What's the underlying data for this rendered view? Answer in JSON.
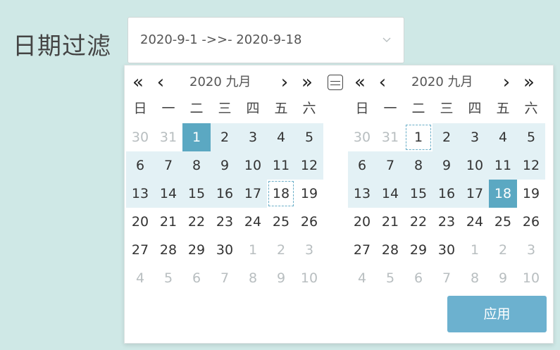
{
  "filter": {
    "label": "日期过滤",
    "range_value": "2020-9-1 ->>- 2020-9-18"
  },
  "calendars": [
    {
      "nav": {
        "prev_year": "«",
        "prev_month": "‹",
        "next_month": "›",
        "next_year": "»"
      },
      "title": "2020 九月",
      "weekdays": [
        "日",
        "一",
        "二",
        "三",
        "四",
        "五",
        "六"
      ],
      "weeks": [
        [
          {
            "d": "30",
            "o": 1
          },
          {
            "d": "31",
            "o": 1
          },
          {
            "d": "1",
            "s": 1
          },
          {
            "d": "2",
            "r": 1
          },
          {
            "d": "3",
            "r": 1
          },
          {
            "d": "4",
            "r": 1
          },
          {
            "d": "5",
            "r": 1
          }
        ],
        [
          {
            "d": "6",
            "r": 1
          },
          {
            "d": "7",
            "r": 1
          },
          {
            "d": "8",
            "r": 1
          },
          {
            "d": "9",
            "r": 1
          },
          {
            "d": "10",
            "r": 1
          },
          {
            "d": "11",
            "r": 1
          },
          {
            "d": "12",
            "r": 1
          }
        ],
        [
          {
            "d": "13",
            "r": 1
          },
          {
            "d": "14",
            "r": 1
          },
          {
            "d": "15",
            "r": 1
          },
          {
            "d": "16",
            "r": 1
          },
          {
            "d": "17",
            "r": 1
          },
          {
            "d": "18",
            "dash": 1
          },
          {
            "d": "19"
          }
        ],
        [
          {
            "d": "20"
          },
          {
            "d": "21"
          },
          {
            "d": "22"
          },
          {
            "d": "23"
          },
          {
            "d": "24"
          },
          {
            "d": "25"
          },
          {
            "d": "26"
          }
        ],
        [
          {
            "d": "27"
          },
          {
            "d": "28"
          },
          {
            "d": "29"
          },
          {
            "d": "30"
          },
          {
            "d": "1",
            "o": 1
          },
          {
            "d": "2",
            "o": 1
          },
          {
            "d": "3",
            "o": 1
          }
        ],
        [
          {
            "d": "4",
            "o": 1
          },
          {
            "d": "5",
            "o": 1
          },
          {
            "d": "6",
            "o": 1
          },
          {
            "d": "7",
            "o": 1
          },
          {
            "d": "8",
            "o": 1
          },
          {
            "d": "9",
            "o": 1
          },
          {
            "d": "10",
            "o": 1
          }
        ]
      ]
    },
    {
      "nav": {
        "prev_year": "«",
        "prev_month": "‹",
        "next_month": "›",
        "next_year": "»"
      },
      "title": "2020 九月",
      "weekdays": [
        "日",
        "一",
        "二",
        "三",
        "四",
        "五",
        "六"
      ],
      "weeks": [
        [
          {
            "d": "30",
            "o": 1
          },
          {
            "d": "31",
            "o": 1
          },
          {
            "d": "1",
            "dash": 1
          },
          {
            "d": "2",
            "r": 1
          },
          {
            "d": "3",
            "r": 1
          },
          {
            "d": "4",
            "r": 1
          },
          {
            "d": "5",
            "r": 1
          }
        ],
        [
          {
            "d": "6",
            "r": 1
          },
          {
            "d": "7",
            "r": 1
          },
          {
            "d": "8",
            "r": 1
          },
          {
            "d": "9",
            "r": 1
          },
          {
            "d": "10",
            "r": 1
          },
          {
            "d": "11",
            "r": 1
          },
          {
            "d": "12",
            "r": 1
          }
        ],
        [
          {
            "d": "13",
            "r": 1
          },
          {
            "d": "14",
            "r": 1
          },
          {
            "d": "15",
            "r": 1
          },
          {
            "d": "16",
            "r": 1
          },
          {
            "d": "17",
            "r": 1
          },
          {
            "d": "18",
            "s": 1
          },
          {
            "d": "19"
          }
        ],
        [
          {
            "d": "20"
          },
          {
            "d": "21"
          },
          {
            "d": "22"
          },
          {
            "d": "23"
          },
          {
            "d": "24"
          },
          {
            "d": "25"
          },
          {
            "d": "26"
          }
        ],
        [
          {
            "d": "27"
          },
          {
            "d": "28"
          },
          {
            "d": "29"
          },
          {
            "d": "30"
          },
          {
            "d": "1",
            "o": 1
          },
          {
            "d": "2",
            "o": 1
          },
          {
            "d": "3",
            "o": 1
          }
        ],
        [
          {
            "d": "4",
            "o": 1
          },
          {
            "d": "5",
            "o": 1
          },
          {
            "d": "6",
            "o": 1
          },
          {
            "d": "7",
            "o": 1
          },
          {
            "d": "8",
            "o": 1
          },
          {
            "d": "9",
            "o": 1
          },
          {
            "d": "10",
            "o": 1
          }
        ]
      ]
    }
  ],
  "apply_label": "应用",
  "colors": {
    "background": "#cfe8e6",
    "selected": "#5ba8c2",
    "in_range": "#e3f1f5",
    "apply_button": "#6cb1cf"
  }
}
